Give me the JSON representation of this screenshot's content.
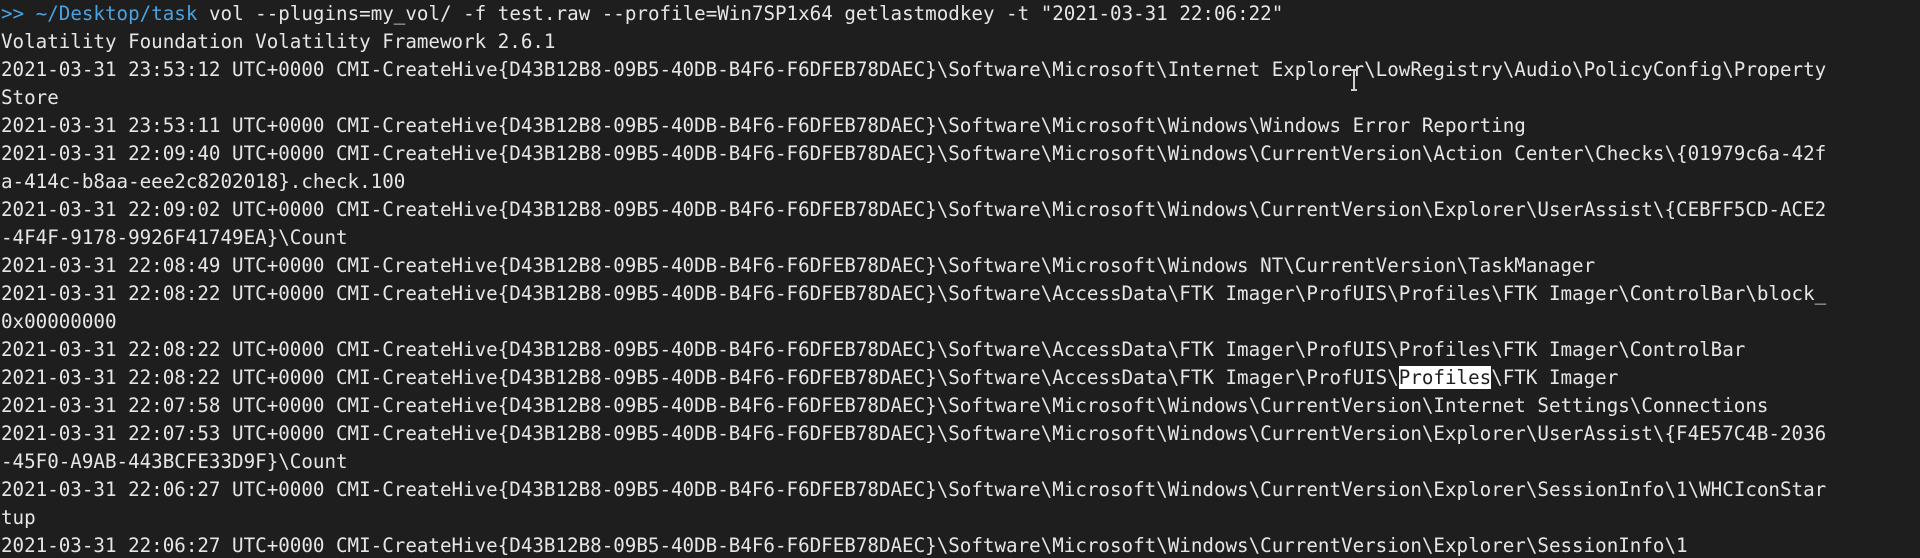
{
  "prompt": {
    "symbol": ">>",
    "cwd": "~/Desktop/task",
    "command": "vol --plugins=my_vol/ -f test.raw --profile=Win7SP1x64 getlastmodkey -t \"2021-03-31 22:06:22\""
  },
  "banner": "Volatility Foundation Volatility Framework 2.6.1",
  "lines": [
    "2021-03-31 23:53:12 UTC+0000 CMI-CreateHive{D43B12B8-09B5-40DB-B4F6-F6DFEB78DAEC}\\Software\\Microsoft\\Internet Explorer\\LowRegistry\\Audio\\PolicyConfig\\Property",
    "Store",
    "2021-03-31 23:53:11 UTC+0000 CMI-CreateHive{D43B12B8-09B5-40DB-B4F6-F6DFEB78DAEC}\\Software\\Microsoft\\Windows\\Windows Error Reporting",
    "2021-03-31 22:09:40 UTC+0000 CMI-CreateHive{D43B12B8-09B5-40DB-B4F6-F6DFEB78DAEC}\\Software\\Microsoft\\Windows\\CurrentVersion\\Action Center\\Checks\\{01979c6a-42f",
    "a-414c-b8aa-eee2c8202018}.check.100",
    "2021-03-31 22:09:02 UTC+0000 CMI-CreateHive{D43B12B8-09B5-40DB-B4F6-F6DFEB78DAEC}\\Software\\Microsoft\\Windows\\CurrentVersion\\Explorer\\UserAssist\\{CEBFF5CD-ACE2",
    "-4F4F-9178-9926F41749EA}\\Count",
    "2021-03-31 22:08:49 UTC+0000 CMI-CreateHive{D43B12B8-09B5-40DB-B4F6-F6DFEB78DAEC}\\Software\\Microsoft\\Windows NT\\CurrentVersion\\TaskManager",
    "2021-03-31 22:08:22 UTC+0000 CMI-CreateHive{D43B12B8-09B5-40DB-B4F6-F6DFEB78DAEC}\\Software\\AccessData\\FTK Imager\\ProfUIS\\Profiles\\FTK Imager\\ControlBar\\block_",
    "0x00000000",
    "2021-03-31 22:08:22 UTC+0000 CMI-CreateHive{D43B12B8-09B5-40DB-B4F6-F6DFEB78DAEC}\\Software\\AccessData\\FTK Imager\\ProfUIS\\Profiles\\FTK Imager\\ControlBar"
  ],
  "selected_line": {
    "before": "2021-03-31 22:08:22 UTC+0000 CMI-CreateHive{D43B12B8-09B5-40DB-B4F6-F6DFEB78DAEC}\\Software\\AccessData\\FTK Imager\\ProfUIS\\",
    "selection": "Profiles",
    "after": "\\FTK Imager"
  },
  "lines_after": [
    "2021-03-31 22:07:58 UTC+0000 CMI-CreateHive{D43B12B8-09B5-40DB-B4F6-F6DFEB78DAEC}\\Software\\Microsoft\\Windows\\CurrentVersion\\Internet Settings\\Connections",
    "2021-03-31 22:07:53 UTC+0000 CMI-CreateHive{D43B12B8-09B5-40DB-B4F6-F6DFEB78DAEC}\\Software\\Microsoft\\Windows\\CurrentVersion\\Explorer\\UserAssist\\{F4E57C4B-2036",
    "-45F0-A9AB-443BCFE33D9F}\\Count",
    "2021-03-31 22:06:27 UTC+0000 CMI-CreateHive{D43B12B8-09B5-40DB-B4F6-F6DFEB78DAEC}\\Software\\Microsoft\\Windows\\CurrentVersion\\Explorer\\SessionInfo\\1\\WHCIconStar",
    "tup",
    "2021-03-31 22:06:27 UTC+0000 CMI-CreateHive{D43B12B8-09B5-40DB-B4F6-F6DFEB78DAEC}\\Software\\Microsoft\\Windows\\CurrentVersion\\Explorer\\SessionInfo\\1"
  ],
  "colors": {
    "background": "#1e1e1e",
    "foreground": "#e6e6e6",
    "prompt": "#4aa3e0",
    "selection_bg": "#ffffff",
    "selection_fg": "#1e1e1e"
  },
  "cursor_icon": "ibeam-cursor-icon"
}
